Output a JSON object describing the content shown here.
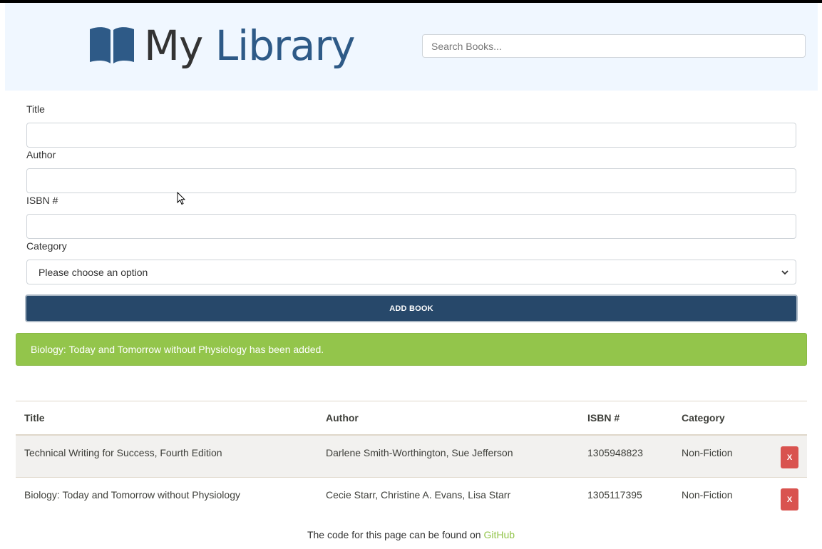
{
  "header": {
    "brand_my": "My",
    "brand_library": "Library",
    "search_placeholder": "Search Books..."
  },
  "form": {
    "title_label": "Title",
    "author_label": "Author",
    "isbn_label": "ISBN #",
    "category_label": "Category",
    "category_selected": "Please choose an option",
    "submit_label": "ADD BOOK"
  },
  "alert": {
    "message": "Biology: Today and Tomorrow without Physiology has been added."
  },
  "table": {
    "headers": [
      "Title",
      "Author",
      "ISBN #",
      "Category"
    ],
    "rows": [
      {
        "title": "Technical Writing for Success, Fourth Edition",
        "author": "Darlene Smith-Worthington, Sue Jefferson",
        "isbn": "1305948823",
        "category": "Non-Fiction",
        "delete_label": "X"
      },
      {
        "title": "Biology: Today and Tomorrow without Physiology",
        "author": "Cecie Starr, Christine A. Evans, Lisa Starr",
        "isbn": "1305117395",
        "category": "Non-Fiction",
        "delete_label": "X"
      }
    ]
  },
  "footer": {
    "text": "The code for this page can be found on",
    "link_label": "GitHub"
  },
  "colors": {
    "brand_blue": "#2e5a87",
    "button_navy": "#27486a",
    "success_green": "#93c54b",
    "danger_red": "#d9534f"
  }
}
